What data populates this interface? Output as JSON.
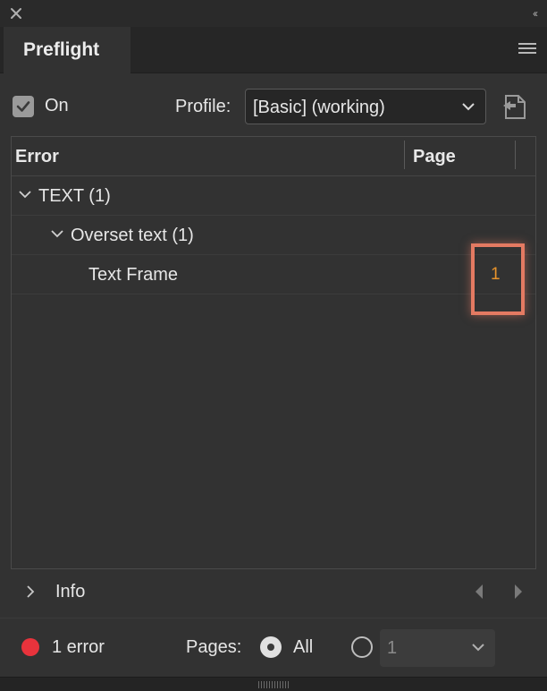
{
  "panel": {
    "tab_label": "Preflight"
  },
  "toolbar": {
    "on_checked": true,
    "on_label": "On",
    "profile_label": "Profile:",
    "profile_value": "[Basic] (working)"
  },
  "table": {
    "headers": {
      "error": "Error",
      "page": "Page"
    },
    "rows": [
      {
        "label": "TEXT (1)",
        "level": 0,
        "expanded": true,
        "page": ""
      },
      {
        "label": "Overset text (1)",
        "level": 1,
        "expanded": true,
        "page": ""
      },
      {
        "label": "Text Frame",
        "level": 2,
        "page": "1"
      }
    ]
  },
  "info": {
    "label": "Info",
    "expanded": false
  },
  "status": {
    "error_text": "1 error",
    "error_color": "#e8333c",
    "pages_label": "Pages:",
    "all_label": "All",
    "all_selected": true,
    "range_value": "1"
  },
  "colors": {
    "page_link": "#e8932b",
    "highlight": "#e47a62"
  }
}
